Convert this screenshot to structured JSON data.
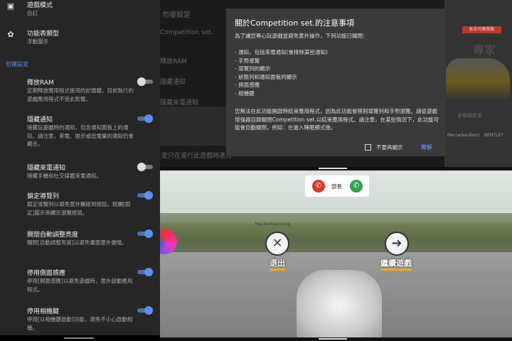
{
  "settings": {
    "items_top": [
      {
        "title": "遊戲模式",
        "sub": "自訂"
      },
      {
        "title": "功能表類型",
        "sub": "浮動圖示"
      }
    ],
    "section": "勿擾設定",
    "rows": [
      {
        "title": "釋放RAM",
        "sub": "定期釋放應用程式使用的記憶體，目前執行的遊戲應用程式不受此影響。",
        "on": false
      },
      {
        "title": "隱藏通知",
        "sub": "隱藏玩遊戲時的通知，包含通知面板上的通知。請注意，來電、提示或低電量的通知仍會顯示。",
        "on": true
      },
      {
        "title": "隱藏來電通知",
        "sub": "隱藏手機和社交媒體來電通知。",
        "on": false
      },
      {
        "title": "鎖定導覽列",
        "sub": "鎖定導覽列以避免意外觸碰到按鈕。輕觸[鎖定]圖示來顯示瀏覽按鈕。",
        "on": true
      },
      {
        "title": "關閉自動調整亮度",
        "sub": "關閉[自動調整亮度]以避免畫面意外變暗。",
        "on": true
      },
      {
        "title": "停用側面感應",
        "sub": "停用[側面感應]以避免遊戲時，意外啟動應用程式。",
        "on": true
      },
      {
        "title": "停用相機鍵",
        "sub": "停用[以相機鍵啟動]功能，避免不小心啟動相機。",
        "on": true
      }
    ]
  },
  "top_app": {
    "section_label": "勿擾設定",
    "competition_label": "Competition set.",
    "rows": [
      "釋放RAM",
      "隱藏通知",
      "隱藏來電通知"
    ],
    "bottom_note": "定只在進行此遊戲時適用"
  },
  "car_card": {
    "header": "客系列賽獎勵",
    "name": "專家",
    "label": "豪華轎跑車",
    "brands": [
      "Mercedes-Benz",
      "BENTLEY"
    ]
  },
  "dialog": {
    "title": "關於Competition set.的注意事項",
    "intro": "為了讓您專心玩遊戲並避免意外操作，下列功能已關閉：",
    "items": [
      "- 通知，包括來電通知(會排除某些通知)",
      "- 手勢瀏覽",
      "- 導覽列的顯示",
      "- 狀態列和通知面板的顯示",
      "- 側面感應",
      "- 相機鍵"
    ],
    "note": "您無法在此功能開啟時結束應用程式，因為此功能會限制導覽列和手勢瀏覽。請從遊戲增強器目錄關閉Competition set.以結束應用程式。請注意，在某些情況下，此功能可能會自動關閉，例如：在進入睡眠模式後。",
    "checkbox_label": "不要再顯示",
    "ok_label": "瞭解"
  },
  "game": {
    "caption": "Hockenheimring",
    "call_name": "部長",
    "exit_label": "退出",
    "continue_label": "繼續遊戲"
  },
  "colors": {
    "accent": "#5b8ff5",
    "dialog_bg": "#3a3a3a",
    "panel_bg": "#262626",
    "button_underline": "#f0a81c"
  }
}
